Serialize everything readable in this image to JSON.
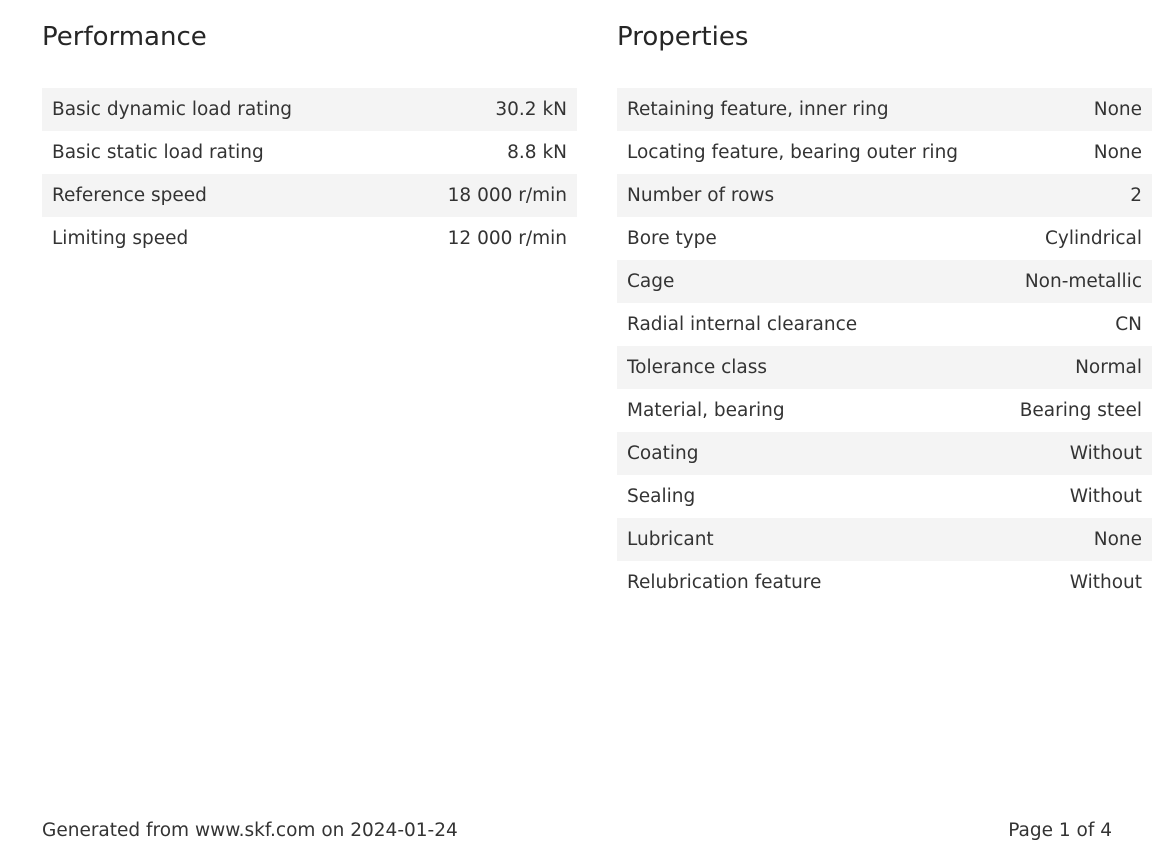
{
  "performance": {
    "title": "Performance",
    "rows": [
      {
        "label": "Basic dynamic load rating",
        "value": "30.2 kN"
      },
      {
        "label": "Basic static load rating",
        "value": "8.8 kN"
      },
      {
        "label": "Reference speed",
        "value": "18 000 r/min"
      },
      {
        "label": "Limiting speed",
        "value": "12 000 r/min"
      }
    ]
  },
  "properties": {
    "title": "Properties",
    "rows": [
      {
        "label": "Retaining feature, inner ring",
        "value": "None"
      },
      {
        "label": "Locating feature, bearing outer ring",
        "value": "None"
      },
      {
        "label": "Number of rows",
        "value": "2"
      },
      {
        "label": "Bore type",
        "value": "Cylindrical"
      },
      {
        "label": "Cage",
        "value": "Non-metallic"
      },
      {
        "label": "Radial internal clearance",
        "value": "CN"
      },
      {
        "label": "Tolerance class",
        "value": "Normal"
      },
      {
        "label": "Material, bearing",
        "value": "Bearing steel"
      },
      {
        "label": "Coating",
        "value": "Without"
      },
      {
        "label": "Sealing",
        "value": "Without"
      },
      {
        "label": "Lubricant",
        "value": "None"
      },
      {
        "label": "Relubrication feature",
        "value": "Without"
      }
    ]
  },
  "footer": {
    "generated_text": "Generated from www.skf.com on 2024-01-24",
    "page_text": "Page 1 of 4"
  }
}
